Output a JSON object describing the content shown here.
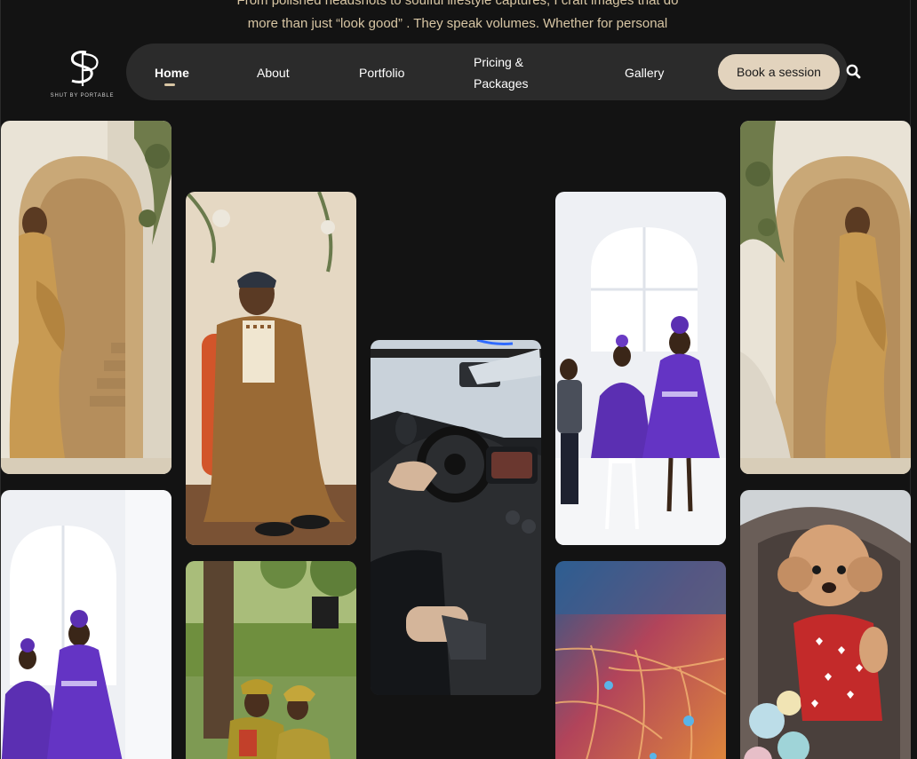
{
  "intro": {
    "line1": "From polished headshots to soulful lifestyle captures, I craft images that do",
    "line2": "more than just “look good” . They speak volumes. Whether for personal"
  },
  "logo": {
    "monogram": "SP",
    "tagline": "SHUT BY PORTABLE"
  },
  "nav": {
    "home": "Home",
    "about": "About",
    "portfolio": "Portfolio",
    "pricing_line1": "Pricing &",
    "pricing_line2": "Packages",
    "gallery": "Gallery",
    "book": "Book a session"
  },
  "icons": {
    "search": "search-icon"
  },
  "colors": {
    "background": "#131313",
    "navbar": "#2b2b2b",
    "accent": "#e2d3bd",
    "intro_text": "#d8c6a4"
  },
  "gallery": [
    {
      "name": "photo-bride-arch-left"
    },
    {
      "name": "photo-man-agbada"
    },
    {
      "name": "photo-car-interior"
    },
    {
      "name": "photo-children-purple"
    },
    {
      "name": "photo-bride-arch-right"
    },
    {
      "name": "photo-girls-purple"
    },
    {
      "name": "photo-couple-park"
    },
    {
      "name": "photo-leaf-macro"
    },
    {
      "name": "photo-puppy-sweater"
    }
  ]
}
